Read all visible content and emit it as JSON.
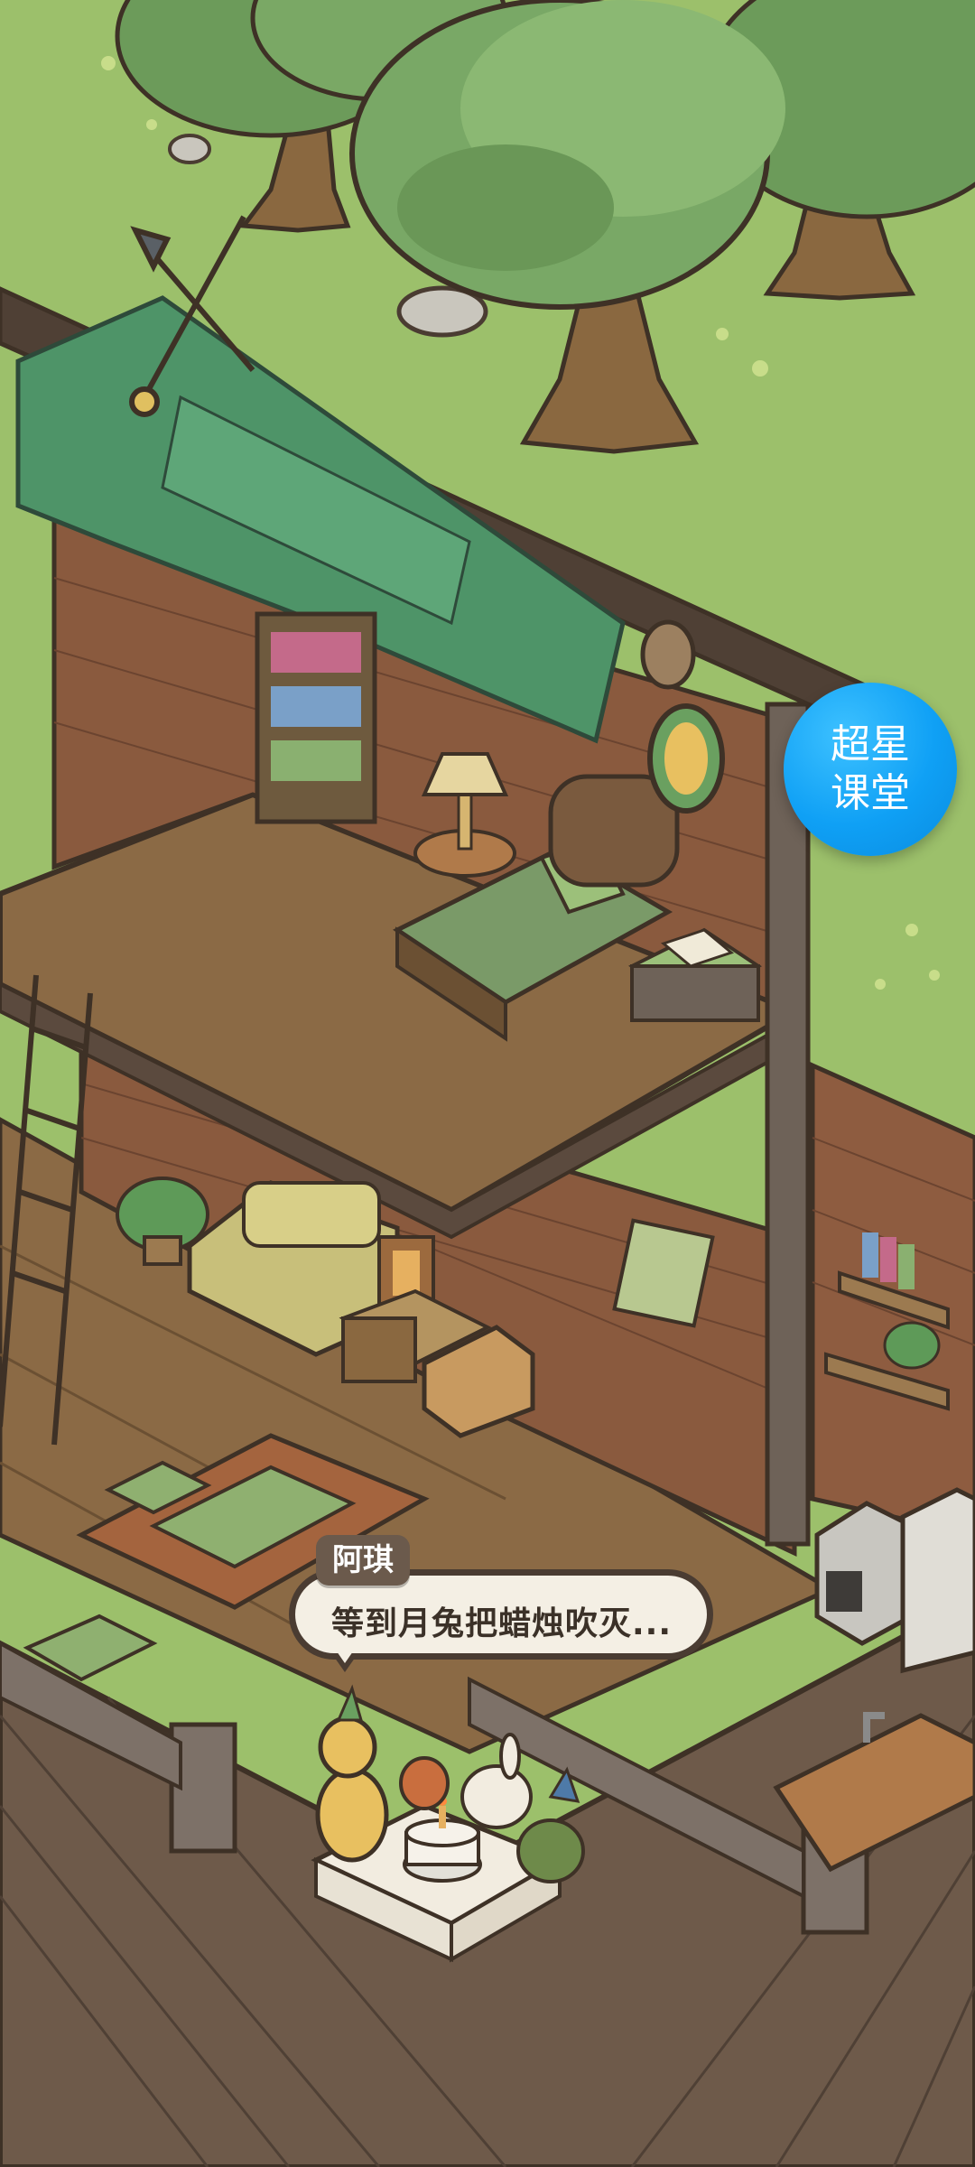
{
  "dialogue": {
    "speaker": "阿琪",
    "text": "等到月兔把蜡烛吹灭..."
  },
  "floating_button": {
    "line1": "超星",
    "line2": "课堂"
  },
  "colors": {
    "grass": "#9cc06b",
    "roof": "#4e9468",
    "brick": "#8a5a3e",
    "floor": "#8b6a45",
    "button_blue": "#0fa0f5"
  }
}
